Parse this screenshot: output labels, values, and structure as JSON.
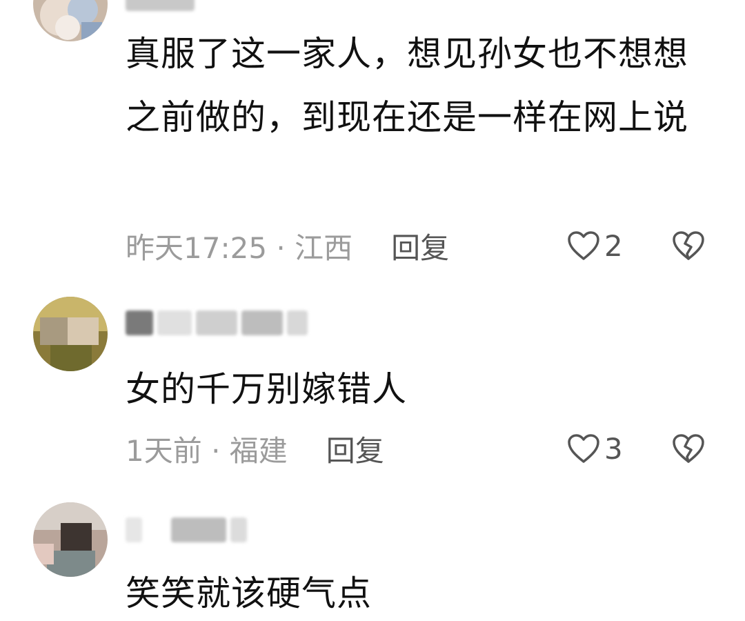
{
  "comments": [
    {
      "username": "",
      "text": "真服了这一家人，想见孙女也不想想之前做的，到现在还是一样在网上说",
      "time_location": "昨天17:25 · 江西",
      "reply_label": "回复",
      "likes": "2"
    },
    {
      "username": "",
      "text": "女的千万别嫁错人",
      "time_location": "1天前 · 福建",
      "reply_label": "回复",
      "likes": "3"
    },
    {
      "username": "",
      "text": "笑笑就该硬气点"
    }
  ],
  "icons": {
    "like": "heart-outline-icon",
    "dislike": "broken-heart-icon"
  },
  "colors": {
    "text": "#111111",
    "meta": "#9b9b9b",
    "action": "#555555"
  }
}
